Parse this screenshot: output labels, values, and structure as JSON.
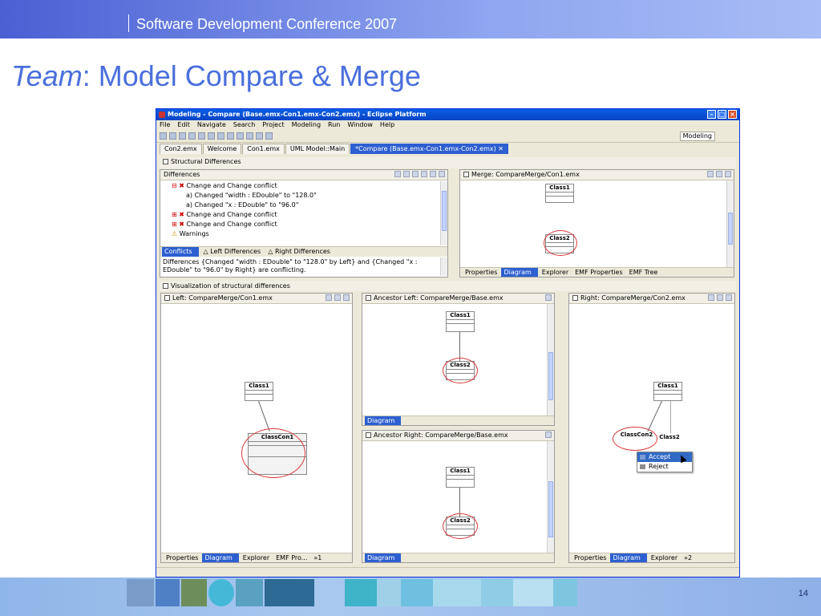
{
  "slide": {
    "conference": "Software Development Conference 2007",
    "title_em": "Team",
    "title_rest": ": Model Compare & Merge",
    "page_number": "14"
  },
  "window": {
    "title": "Modeling - Compare (Base.emx-Con1.emx-Con2.emx) - Eclipse Platform",
    "menu": [
      "File",
      "Edit",
      "Navigate",
      "Search",
      "Project",
      "Modeling",
      "Run",
      "Window",
      "Help"
    ],
    "perspective": "Modeling",
    "editor_tabs": [
      {
        "label": "Con2.emx",
        "active": false
      },
      {
        "label": "Welcome",
        "active": false
      },
      {
        "label": "Con1.emx",
        "active": false
      },
      {
        "label": "UML Model::Main",
        "active": false
      },
      {
        "label": "*Compare (Base.emx-Con1.emx-Con2.emx) ✕",
        "active": true
      }
    ]
  },
  "structural": {
    "header": "Structural Differences",
    "differences_header": "Differences",
    "tree": [
      {
        "indent": 0,
        "text": "Change and Change conflict",
        "icon": "conflict-icon"
      },
      {
        "indent": 1,
        "text": "Changed \"width : EDouble\" to \"128.0\"",
        "icon": "attribute-icon"
      },
      {
        "indent": 1,
        "text": "Changed \"x : EDouble\" to \"96.0\"",
        "icon": "attribute-icon"
      },
      {
        "indent": 0,
        "text": "Change and Change conflict",
        "icon": "conflict-icon"
      },
      {
        "indent": 0,
        "text": "Change and Change conflict",
        "icon": "conflict-icon"
      },
      {
        "indent": 0,
        "text": "Warnings",
        "icon": "warning-icon"
      }
    ],
    "bottom_tabs": [
      "Conflicts",
      "Left Differences",
      "Right Differences"
    ],
    "description": "Differences {Changed \"width : EDouble\" to \"128.0\" by Left} and {Changed \"x : EDouble\" to \"96.0\" by Right} are conflicting."
  },
  "merge": {
    "header": "Merge: CompareMerge/Con1.emx",
    "class_top": "Class1",
    "class_bottom": "Class2",
    "bottom_tabs": [
      "Properties",
      "Diagram",
      "Explorer",
      "EMF Properties",
      "EMF Tree"
    ]
  },
  "visualization": {
    "header": "Visualization of structural differences"
  },
  "left": {
    "header": "Left: CompareMerge/Con1.emx",
    "class_top": "Class1",
    "class_bottom": "ClassCon1",
    "bottom_tabs": [
      "Properties",
      "Diagram",
      "Explorer",
      "EMF Pro...",
      "»1"
    ]
  },
  "ancestor_left": {
    "header": "Ancestor Left: CompareMerge/Base.emx",
    "class_top": "Class1",
    "class_bottom": "Class2",
    "bottom_tab": "Diagram"
  },
  "ancestor_right": {
    "header": "Ancestor Right: CompareMerge/Base.emx",
    "class_top": "Class1",
    "class_bottom": "Class2",
    "bottom_tab": "Diagram"
  },
  "right": {
    "header": "Right: CompareMerge/Con2.emx",
    "class_top": "Class1",
    "class_con": "ClassCon2",
    "class_two": "Class2",
    "context_menu": [
      "Accept",
      "Reject"
    ],
    "bottom_tabs": [
      "Properties",
      "Diagram",
      "Explorer",
      "»2"
    ]
  },
  "colors": {
    "accent": "#4a6fdc",
    "highlight_ellipse": "#d9383a",
    "active_tab": "#2d5fd0"
  }
}
